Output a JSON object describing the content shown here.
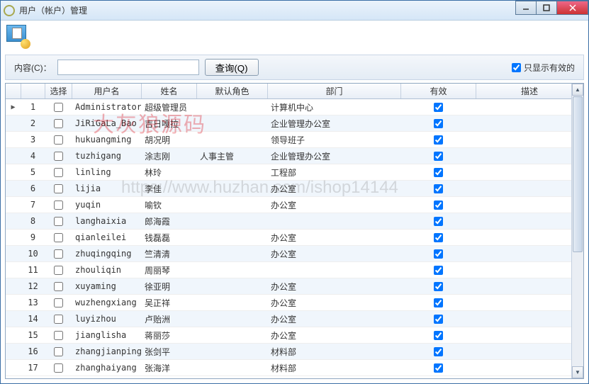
{
  "window": {
    "title": "用户（帐户）管理"
  },
  "search": {
    "label": "内容(C)：",
    "value": "",
    "btn": "查询(Q)",
    "valid_only": "只显示有效的",
    "valid_only_checked": true
  },
  "columns": {
    "select": "选择",
    "username": "用户名",
    "name": "姓名",
    "default_role": "默认角色",
    "department": "部门",
    "valid": "有效",
    "description": "描述"
  },
  "rows": [
    {
      "ptr": "▶",
      "no": "1",
      "sel": false,
      "user": "Administrator",
      "name": "超级管理员",
      "role": "",
      "dept": "计算机中心",
      "valid": true,
      "desc": ""
    },
    {
      "ptr": "",
      "no": "2",
      "sel": false,
      "user": "JiRiGaLa_Bao",
      "name": "吉日嘎拉",
      "role": "",
      "dept": "企业管理办公室",
      "valid": true,
      "desc": ""
    },
    {
      "ptr": "",
      "no": "3",
      "sel": false,
      "user": "hukuangming",
      "name": "胡况明",
      "role": "",
      "dept": "领导班子",
      "valid": true,
      "desc": ""
    },
    {
      "ptr": "",
      "no": "4",
      "sel": false,
      "user": "tuzhigang",
      "name": "涂志刚",
      "role": "人事主管",
      "dept": "企业管理办公室",
      "valid": true,
      "desc": ""
    },
    {
      "ptr": "",
      "no": "5",
      "sel": false,
      "user": "linling",
      "name": "林玲",
      "role": "",
      "dept": "工程部",
      "valid": true,
      "desc": ""
    },
    {
      "ptr": "",
      "no": "6",
      "sel": false,
      "user": "lijia",
      "name": "李佳",
      "role": "",
      "dept": "办公室",
      "valid": true,
      "desc": ""
    },
    {
      "ptr": "",
      "no": "7",
      "sel": false,
      "user": "yuqin",
      "name": "喻钦",
      "role": "",
      "dept": "办公室",
      "valid": true,
      "desc": ""
    },
    {
      "ptr": "",
      "no": "8",
      "sel": false,
      "user": "langhaixia",
      "name": "郎海霞",
      "role": "",
      "dept": "",
      "valid": true,
      "desc": ""
    },
    {
      "ptr": "",
      "no": "9",
      "sel": false,
      "user": "qianleilei",
      "name": "钱磊磊",
      "role": "",
      "dept": "办公室",
      "valid": true,
      "desc": ""
    },
    {
      "ptr": "",
      "no": "10",
      "sel": false,
      "user": "zhuqingqing",
      "name": "竺清清",
      "role": "",
      "dept": "办公室",
      "valid": true,
      "desc": ""
    },
    {
      "ptr": "",
      "no": "11",
      "sel": false,
      "user": "zhouliqin",
      "name": "周丽琴",
      "role": "",
      "dept": "",
      "valid": true,
      "desc": ""
    },
    {
      "ptr": "",
      "no": "12",
      "sel": false,
      "user": "xuyaming",
      "name": "徐亚明",
      "role": "",
      "dept": "办公室",
      "valid": true,
      "desc": ""
    },
    {
      "ptr": "",
      "no": "13",
      "sel": false,
      "user": "wuzhengxiang",
      "name": "吴正祥",
      "role": "",
      "dept": "办公室",
      "valid": true,
      "desc": ""
    },
    {
      "ptr": "",
      "no": "14",
      "sel": false,
      "user": "luyizhou",
      "name": "卢贻洲",
      "role": "",
      "dept": "办公室",
      "valid": true,
      "desc": ""
    },
    {
      "ptr": "",
      "no": "15",
      "sel": false,
      "user": "jianglisha",
      "name": "蒋丽莎",
      "role": "",
      "dept": "办公室",
      "valid": true,
      "desc": ""
    },
    {
      "ptr": "",
      "no": "16",
      "sel": false,
      "user": "zhangjianping",
      "name": "张剑平",
      "role": "",
      "dept": "材料部",
      "valid": true,
      "desc": ""
    },
    {
      "ptr": "",
      "no": "17",
      "sel": false,
      "user": "zhanghaiyang",
      "name": "张海洋",
      "role": "",
      "dept": "材料部",
      "valid": true,
      "desc": ""
    }
  ],
  "watermarks": {
    "w1": "大灰狼源码",
    "w2": "https://www.huzhan.com/ishop14144"
  }
}
